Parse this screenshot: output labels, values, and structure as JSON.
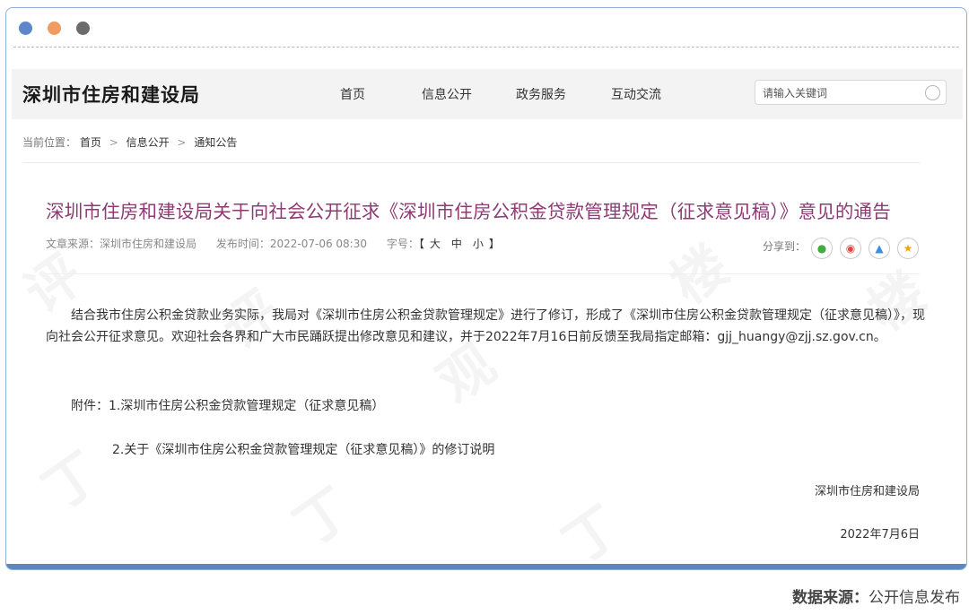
{
  "window": {
    "dots": [
      "blue",
      "orange",
      "gray"
    ]
  },
  "header": {
    "logo": "深圳市住房和建设局",
    "nav": [
      "首页",
      "信息公开",
      "政务服务",
      "互动交流"
    ],
    "search_placeholder": "请输入关键词",
    "search_icon": "search-icon"
  },
  "breadcrumb": {
    "prefix": "当前位置：",
    "items": [
      "首页",
      "信息公开",
      "通知公告"
    ],
    "separator": ">"
  },
  "article": {
    "title": "深圳市住房和建设局关于向社会公开征求《深圳市住房公积金贷款管理规定（征求意见稿）》意见的通告",
    "source": "文章来源：深圳市住房和建设局",
    "publish_time": "发布时间：2022-07-06 08:30",
    "font_label": "字号：",
    "font_open": "【",
    "font_sizes": [
      "大",
      "中",
      "小"
    ],
    "font_close": "】",
    "share_label": "分享到：",
    "share_icons": [
      "wechat-icon",
      "weibo-icon",
      "qq-icon",
      "favorite-icon"
    ],
    "paragraph1": "结合我市住房公积金贷款业务实际，我局对《深圳市住房公积金贷款管理规定》进行了修订，形成了《深圳市住房公积金贷款管理规定（征求意见稿）》，现向社会公开征求意见。欢迎社会各界和广大市民踊跃提出修改意见和建议，并于2022年7月16日前反馈至我局指定邮箱：gjj_huangy@zjj.sz.gov.cn。",
    "attachment1": "附件：1.深圳市住房公积金贷款管理规定（征求意见稿）",
    "attachment2": "2.关于《深圳市住房公积金贷款管理规定（征求意见稿）》的修订说明",
    "sign_org": "深圳市住房和建设局",
    "sign_date": "2022年7月6日"
  },
  "caption": {
    "label": "数据来源：",
    "value": "公开信息发布"
  },
  "colors": {
    "title": "#8e3a73",
    "accent_bar": "#5b86c2"
  }
}
